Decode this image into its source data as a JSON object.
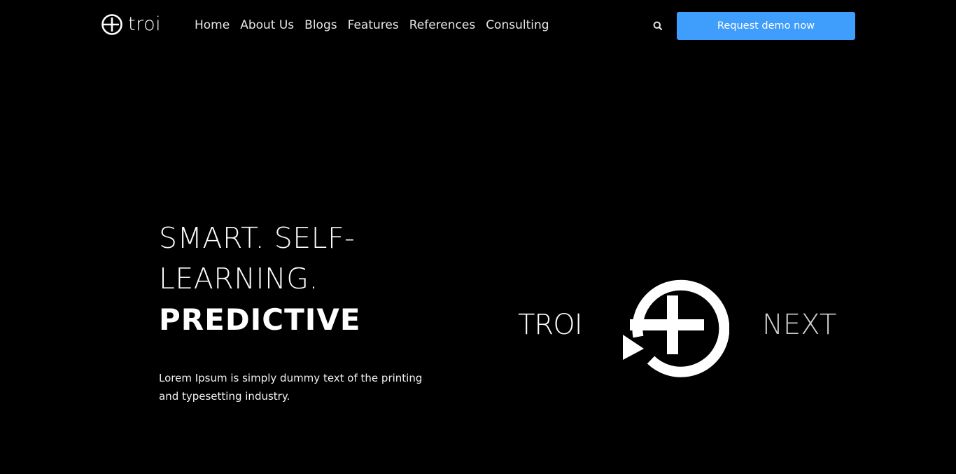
{
  "header": {
    "logo_text": "troi",
    "logo_icon": "troi-plus-circle-icon",
    "nav": [
      {
        "label": "Home"
      },
      {
        "label": "About Us"
      },
      {
        "label": "Blogs"
      },
      {
        "label": "Features"
      },
      {
        "label": "References"
      },
      {
        "label": "Consulting"
      }
    ],
    "search_icon": "search-icon",
    "cta_label": "Request demo now"
  },
  "hero": {
    "line1": "SMART. SELF-",
    "line2": "LEARNING.",
    "line3": "PREDICTIVE",
    "description": "Lorem Ipsum is simply dummy text of the printing and typesetting industry."
  },
  "brand": {
    "left_word": "TROI",
    "right_word": "NEXT",
    "mark_icon": "troi-refresh-plus-icon"
  },
  "colors": {
    "background": "#000000",
    "accent": "#3f9dfb",
    "text": "#ffffff",
    "nav_text": "#e6e6e6",
    "muted_word": "#cfcfcf"
  }
}
